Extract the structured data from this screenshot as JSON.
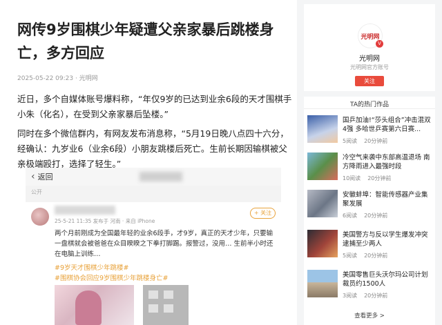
{
  "article": {
    "title": "网传9岁围棋少年疑遭父亲家暴后跳楼身亡，多方回应",
    "meta": "2025-05-22 09:23 · 光明网",
    "paragraphs": [
      "近日，多个自媒体账号爆料称，“年仅9岁的已达到业余6段的天才围棋手小朱（化名），在受到父亲家暴后坠楼。”",
      "同时在多个微信群内，有网友发布消息称，“5月19日晚八点四十六分，经确认：九岁业6（业余6段）小朋友跳楼后死亡。生前长期因输棋被父亲极端殴打，选择了轻生。”"
    ],
    "screenshot": {
      "back_label": "返回",
      "public_label": "公开",
      "date_line": "25-5-21 11:35 发布于 河南 · 来自 iPhone",
      "follow_label": "+ 关注",
      "post_text": "两个月前刚成为全国最年轻的业余6段手，才9岁，真正的天才少年，只要输一盘棋就会被爸爸在众目睽睽之下拳打脚踢。报警过，没用… 生前半小时还在电脑上训练…",
      "tags": [
        "#9岁天才围棋少年跳楼#",
        "#围棋协会回应9岁围棋少年跳楼身亡#"
      ]
    }
  },
  "sidebar": {
    "profile": {
      "logo_text": "光明网",
      "name": "光明网",
      "desc": "光明网官方账号",
      "follow_label": "关注"
    },
    "works_title": "TA的热门作品",
    "items": [
      {
        "title": "国乒加油!“莎头组合”冲击混双4强 多哈世乒赛第六日赛...",
        "reads": "5阅读",
        "time": "20分钟前"
      },
      {
        "title": "冷空气来袭中东部高温退场 南方降雨进入最强时段",
        "reads": "10阅读",
        "time": "20分钟前"
      },
      {
        "title": "安徽蚌埠：智能传感器产业集聚发展",
        "reads": "6阅读",
        "time": "20分钟前"
      },
      {
        "title": "美国警方与反以学生爆发冲突 逮捕至少两人",
        "reads": "5阅读",
        "time": "20分钟前"
      },
      {
        "title": "美国零售巨头沃尔玛公司计划裁员约1500人",
        "reads": "3阅读",
        "time": "20分钟前"
      }
    ],
    "more_label": "查看更多 >"
  }
}
